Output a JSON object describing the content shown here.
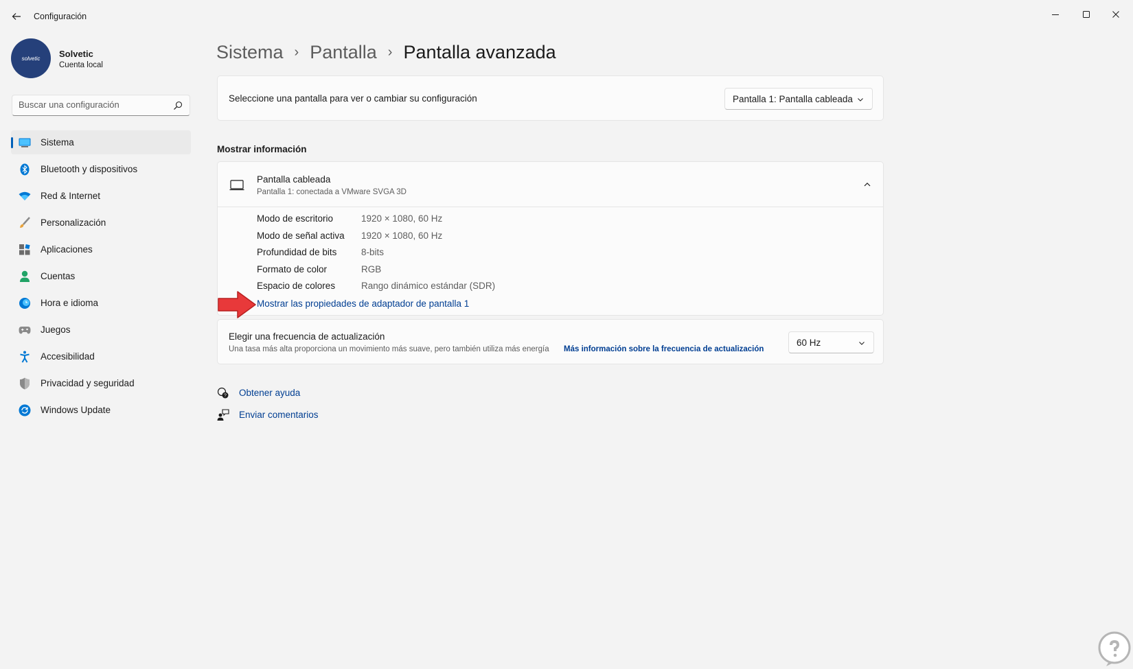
{
  "window": {
    "title": "Configuración"
  },
  "profile": {
    "avatar_text": "solvetic",
    "name": "Solvetic",
    "account_type": "Cuenta local"
  },
  "search": {
    "placeholder": "Buscar una configuración"
  },
  "sidebar": {
    "items": [
      {
        "label": "Sistema",
        "icon": "system-icon",
        "active": true
      },
      {
        "label": "Bluetooth y dispositivos",
        "icon": "bluetooth-icon"
      },
      {
        "label": "Red & Internet",
        "icon": "wifi-icon"
      },
      {
        "label": "Personalización",
        "icon": "brush-icon"
      },
      {
        "label": "Aplicaciones",
        "icon": "apps-icon"
      },
      {
        "label": "Cuentas",
        "icon": "person-icon"
      },
      {
        "label": "Hora e idioma",
        "icon": "clock-globe-icon"
      },
      {
        "label": "Juegos",
        "icon": "gamepad-icon"
      },
      {
        "label": "Accesibilidad",
        "icon": "accessibility-icon"
      },
      {
        "label": "Privacidad y seguridad",
        "icon": "shield-icon"
      },
      {
        "label": "Windows Update",
        "icon": "update-icon"
      }
    ]
  },
  "breadcrumb": {
    "items": [
      "Sistema",
      "Pantalla",
      "Pantalla avanzada"
    ],
    "separator": "›"
  },
  "display_select": {
    "label": "Seleccione una pantalla para ver o cambiar su configuración",
    "value": "Pantalla 1: Pantalla cableada"
  },
  "display_info": {
    "section_title": "Mostrar información",
    "title": "Pantalla cableada",
    "subtitle": "Pantalla 1: conectada a VMware SVGA 3D",
    "rows": [
      {
        "key": "Modo de escritorio",
        "value": "1920 × 1080, 60 Hz"
      },
      {
        "key": "Modo de señal activa",
        "value": "1920 × 1080, 60 Hz"
      },
      {
        "key": "Profundidad de bits",
        "value": "8-bits"
      },
      {
        "key": "Formato de color",
        "value": "RGB"
      },
      {
        "key": "Espacio de colores",
        "value": "Rango dinámico estándar (SDR)"
      }
    ],
    "adapter_link": "Mostrar las propiedades de adaptador de pantalla 1"
  },
  "refresh_rate": {
    "title": "Elegir una frecuencia de actualización",
    "description": "Una tasa más alta proporciona un movimiento más suave, pero también utiliza más energía",
    "link": "Más información sobre la frecuencia de actualización",
    "value": "60 Hz"
  },
  "help": {
    "get_help": "Obtener ayuda",
    "feedback": "Enviar comentarios"
  },
  "colors": {
    "accent": "#005fb8",
    "link": "#003e92",
    "background": "#f3f3f3",
    "card": "#fbfbfb",
    "annotation_arrow": "#e8393a"
  }
}
